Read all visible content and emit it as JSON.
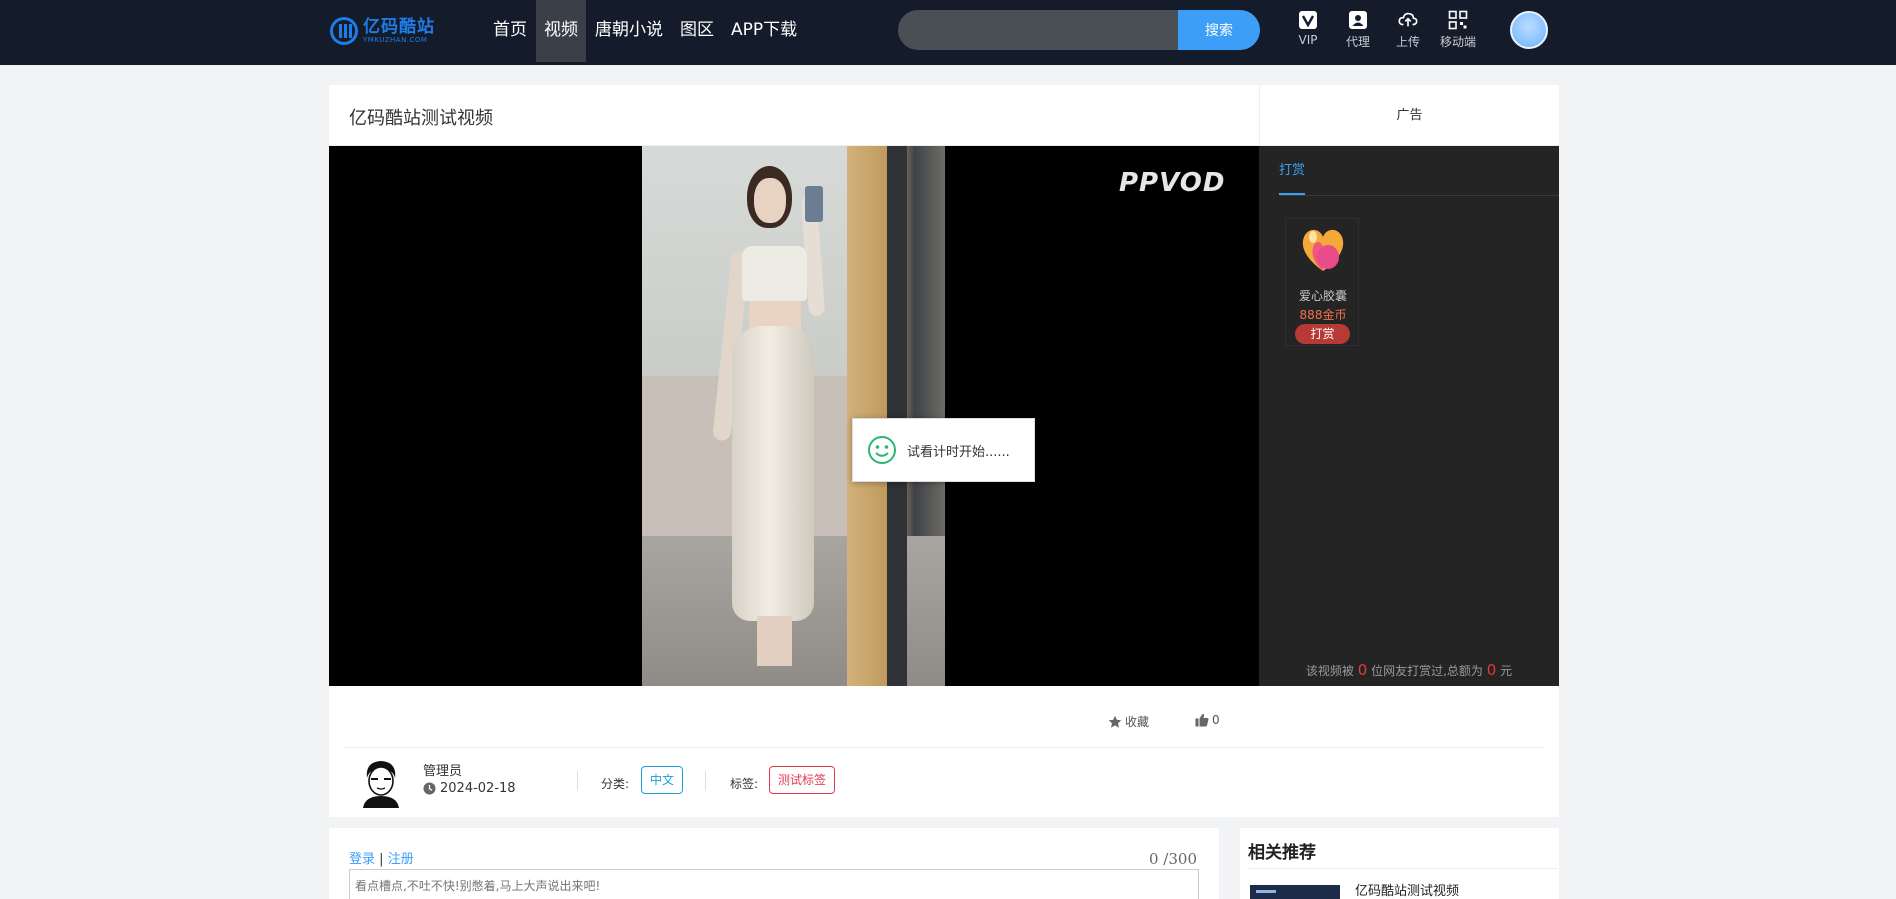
{
  "header": {
    "logo_cn": "亿码酷站",
    "logo_en": "YMKUZHAN.COM",
    "nav": [
      {
        "label": "首页",
        "active": false
      },
      {
        "label": "视频",
        "active": true
      },
      {
        "label": "唐朝小说",
        "active": false
      },
      {
        "label": "图区",
        "active": false
      },
      {
        "label": "APP下载",
        "active": false
      }
    ],
    "search_placeholder": "",
    "search_button": "搜索",
    "tools": [
      {
        "label": "VIP",
        "icon": "vip-icon"
      },
      {
        "label": "代理",
        "icon": "agent-icon"
      },
      {
        "label": "上传",
        "icon": "upload-cloud-icon"
      },
      {
        "label": "移动端",
        "icon": "qr-code-icon"
      }
    ]
  },
  "video": {
    "title": "亿码酷站测试视频",
    "ad_label": "广告",
    "watermark": "PPVOD",
    "toast": "试看计时开始......"
  },
  "reward": {
    "tab": "打赏",
    "gift_name": "爱心胶囊",
    "gift_price": "888金币",
    "gift_button": "打赏",
    "summary_prefix": "该视频被",
    "count": "0",
    "summary_mid": "位网友打赏过,总额为",
    "total": "0",
    "summary_suffix": "元"
  },
  "actions": {
    "favorite": "收藏",
    "likes": "0"
  },
  "meta": {
    "author": "管理员",
    "date": "2024-02-18",
    "category_label": "分类:",
    "category": "中文",
    "tag_label": "标签:",
    "tag": "测试标签"
  },
  "comment": {
    "login": "登录",
    "separator": "|",
    "register": "注册",
    "counter": "0 /300",
    "placeholder": "看点槽点,不吐不快!别憋着,马上大声说出来吧!"
  },
  "related": {
    "title": "相关推荐",
    "items": [
      {
        "title": "亿码酷站测试视频"
      }
    ]
  },
  "colors": {
    "header_bg": "#141c2b",
    "accent": "#3d9ef7",
    "panel_bg": "#242424"
  }
}
